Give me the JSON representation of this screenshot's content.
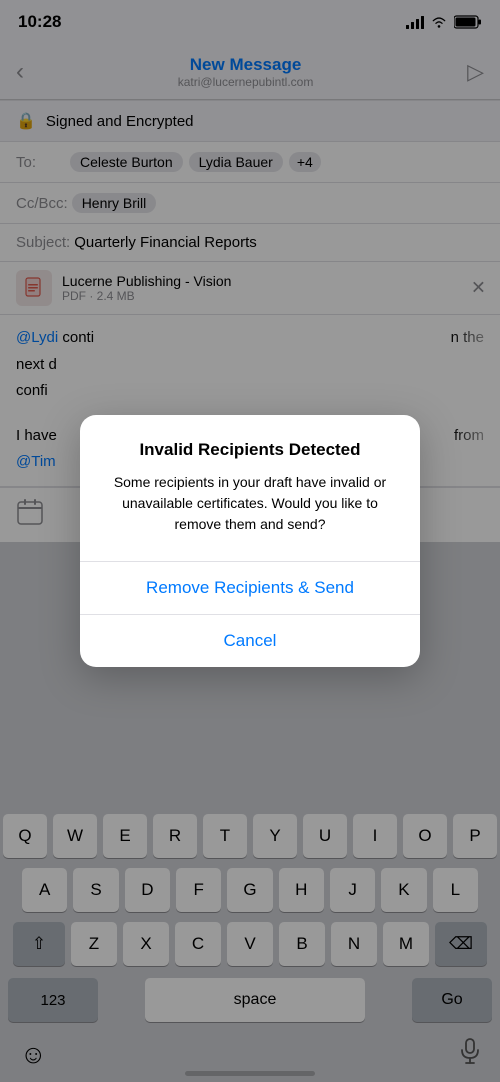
{
  "statusBar": {
    "time": "10:28",
    "signal": "●●●●",
    "wifi": "wifi",
    "battery": "battery"
  },
  "header": {
    "backLabel": "<",
    "title": "New Message",
    "subtitle": "katri@lucernepubintl.com",
    "sendIcon": "▷"
  },
  "security": {
    "label": "Signed and Encrypted"
  },
  "toField": {
    "label": "To:",
    "recipients": [
      "Celeste Burton",
      "Lydia Bauer"
    ],
    "moreCount": "+4"
  },
  "ccBccField": {
    "label": "Cc/Bcc:",
    "value": "Henry Brill"
  },
  "subjectField": {
    "label": "Subject:",
    "value": "Quarterly Financial Reports"
  },
  "attachment": {
    "name": "Lucerne Publishing - Vision",
    "type": "PDF",
    "size": "PDF · 2.4 MB"
  },
  "bodyText": {
    "line1": "@Lydi  conti  the next d  confi",
    "line1_suffix": "n the",
    "line2": "I have  @Tim",
    "line2_suffix": "from"
  },
  "modal": {
    "title": "Invalid Recipients Detected",
    "body": "Some recipients in your draft have invalid or unavailable certificates. Would you like to remove them and send?",
    "primaryAction": "Remove Recipients & Send",
    "cancelAction": "Cancel"
  },
  "keyboard": {
    "row1": [
      "Q",
      "W",
      "E",
      "R",
      "T",
      "Y",
      "U",
      "I",
      "O",
      "P"
    ],
    "row2": [
      "A",
      "S",
      "D",
      "F",
      "G",
      "H",
      "J",
      "K",
      "L"
    ],
    "row3": [
      "Z",
      "X",
      "C",
      "V",
      "B",
      "N",
      "M"
    ],
    "shiftIcon": "⇧",
    "deleteIcon": "⌫",
    "numbersLabel": "123",
    "spaceLabel": "space",
    "goLabel": "Go",
    "emojiIcon": "☺",
    "micIcon": "🎙"
  }
}
